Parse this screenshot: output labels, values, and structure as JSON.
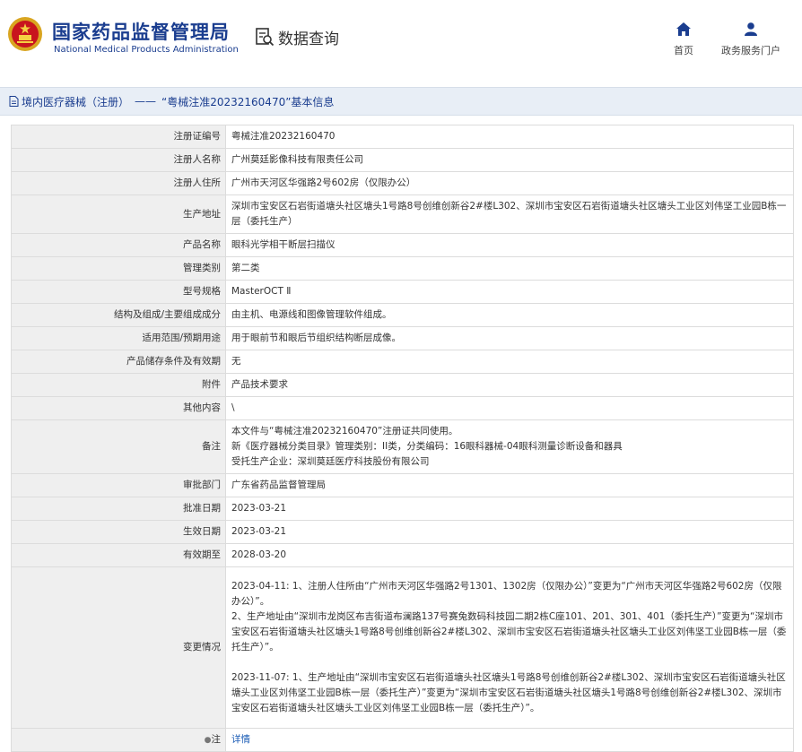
{
  "header": {
    "logo_cn": "国家药品监督管理局",
    "logo_en": "National Medical Products Administration",
    "search_label": "数据查询",
    "nav": [
      {
        "label": "首页",
        "icon": "home-icon"
      },
      {
        "label": "政务服务门户",
        "icon": "user-icon"
      }
    ],
    "brand_color": "#1a3d8f"
  },
  "breadcrumb": {
    "section": "境内医疗器械（注册）",
    "separator": "——",
    "current": "“粤械注准20232160470”基本信息"
  },
  "record": {
    "reg_no": {
      "label": "注册证编号",
      "value": "粤械注准20232160470"
    },
    "registrant": {
      "label": "注册人名称",
      "value": "广州莫廷影像科技有限责任公司"
    },
    "registrant_address": {
      "label": "注册人住所",
      "value": "广州市天河区华强路2号602房（仅限办公）"
    },
    "production_address": {
      "label": "生产地址",
      "value": "深圳市宝安区石岩街道塘头社区塘头1号路8号创维创新谷2#楼L302、深圳市宝安区石岩街道塘头社区塘头工业区刘伟坚工业园B栋一层（委托生产）"
    },
    "product_name": {
      "label": "产品名称",
      "value": "眼科光学相干断层扫描仪"
    },
    "category": {
      "label": "管理类别",
      "value": "第二类"
    },
    "model": {
      "label": "型号规格",
      "value": "MasterOCT Ⅱ"
    },
    "structure": {
      "label": "结构及组成/主要组成成分",
      "value": "由主机、电源线和图像管理软件组成。"
    },
    "scope": {
      "label": "适用范围/预期用途",
      "value": "用于眼前节和眼后节组织结构断层成像。"
    },
    "storage": {
      "label": "产品储存条件及有效期",
      "value": "无"
    },
    "attachment": {
      "label": "附件",
      "value": "产品技术要求"
    },
    "other": {
      "label": "其他内容",
      "value": "\\"
    },
    "remarks": {
      "label": "备注",
      "lines": [
        "本文件与“粤械注准20232160470”注册证共同使用。",
        "新《医疗器械分类目录》管理类别：II类，分类编码：16眼科器械-04眼科测量诊断设备和器具",
        "受托生产企业：深圳莫廷医疗科技股份有限公司"
      ]
    },
    "approval_dept": {
      "label": "审批部门",
      "value": "广东省药品监督管理局"
    },
    "approval_date": {
      "label": "批准日期",
      "value": "2023-03-21"
    },
    "effective_date": {
      "label": "生效日期",
      "value": "2023-03-21"
    },
    "expiry_date": {
      "label": "有效期至",
      "value": "2028-03-20"
    },
    "changes": {
      "label": "变更情况",
      "entries": [
        "2023-04-11: 1、注册人住所由“广州市天河区华强路2号1301、1302房（仅限办公）”变更为“广州市天河区华强路2号602房（仅限办公）”。",
        "2、生产地址由“深圳市龙岗区布吉街道布澜路137号赛兔数码科技园二期2栋C座101、201、301、401（委托生产）”变更为“深圳市宝安区石岩街道塘头社区塘头1号路8号创维创新谷2#楼L302、深圳市宝安区石岩街道塘头社区塘头工业区刘伟坚工业园B栋一层（委托生产）”。",
        "2023-11-07: 1、生产地址由“深圳市宝安区石岩街道塘头社区塘头1号路8号创维创新谷2#楼L302、深圳市宝安区石岩街道塘头社区塘头工业区刘伟坚工业园B栋一层（委托生产）”变更为“深圳市宝安区石岩街道塘头社区塘头1号路8号创维创新谷2#楼L302、深圳市宝安区石岩街道塘头社区塘头工业区刘伟坚工业园B栋一层（委托生产）”。"
      ]
    },
    "note": {
      "label": "注",
      "pin": "●",
      "value": "详情"
    }
  }
}
